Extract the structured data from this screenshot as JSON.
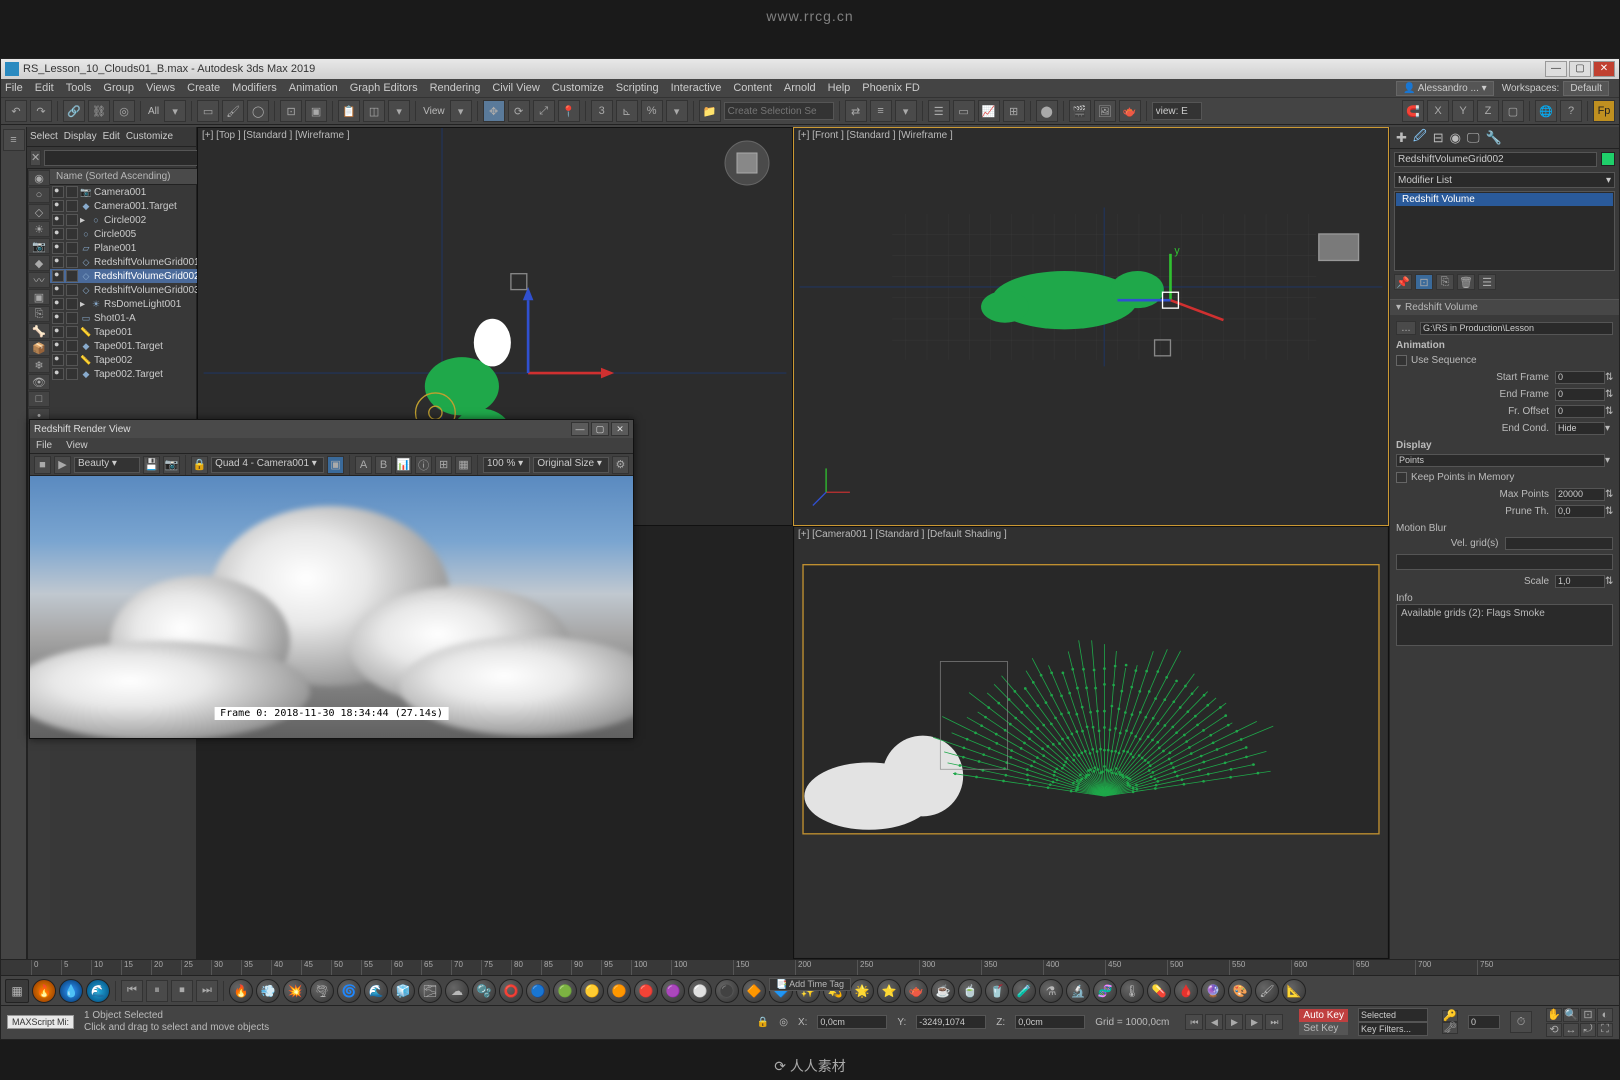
{
  "watermarks": {
    "top": "www.rrcg.cn",
    "bottom": "人人素材"
  },
  "titlebar": {
    "title": "RS_Lesson_10_Clouds01_B.max - Autodesk 3ds Max 2019"
  },
  "main_menu": [
    "File",
    "Edit",
    "Tools",
    "Group",
    "Views",
    "Create",
    "Modifiers",
    "Animation",
    "Graph Editors",
    "Rendering",
    "Civil View",
    "Customize",
    "Scripting",
    "Interactive",
    "Content",
    "Arnold",
    "Help",
    "Phoenix FD"
  ],
  "user": {
    "name": "Alessandro ...",
    "workspace_label": "Workspaces:",
    "workspace_value": "Default"
  },
  "main_toolbar": {
    "all_label": "All",
    "view_label": "View",
    "create_sel_placeholder": "Create Selection Se",
    "view_input": "view: E"
  },
  "scene_explorer": {
    "toolbar": [
      "Select",
      "Display",
      "Edit",
      "Customize"
    ],
    "header": "Name (Sorted Ascending)",
    "items": [
      {
        "name": "Camera001",
        "icon": "📷",
        "vis": true
      },
      {
        "name": "Camera001.Target",
        "icon": "◆",
        "vis": true
      },
      {
        "name": "Circle002",
        "icon": "○",
        "vis": true,
        "expand": true
      },
      {
        "name": "Circle005",
        "icon": "○",
        "vis": true
      },
      {
        "name": "Plane001",
        "icon": "▱",
        "vis": true
      },
      {
        "name": "RedshiftVolumeGrid001",
        "icon": "◇",
        "vis": true
      },
      {
        "name": "RedshiftVolumeGrid002",
        "icon": "◇",
        "vis": true,
        "selected": true
      },
      {
        "name": "RedshiftVolumeGrid003",
        "icon": "◇",
        "vis": true
      },
      {
        "name": "RsDomeLight001",
        "icon": "☀",
        "vis": true,
        "expand": true
      },
      {
        "name": "Shot01-A",
        "icon": "▭",
        "vis": true
      },
      {
        "name": "Tape001",
        "icon": "📏",
        "vis": true
      },
      {
        "name": "Tape001.Target",
        "icon": "◆",
        "vis": true
      },
      {
        "name": "Tape002",
        "icon": "📏",
        "vis": true
      },
      {
        "name": "Tape002.Target",
        "icon": "◆",
        "vis": true
      }
    ]
  },
  "viewports": {
    "top": "[+] [Top ] [Standard ] [Wireframe ]",
    "front": "[+] [Front ] [Standard ] [Wireframe ]",
    "camera": "[+] [Camera001 ] [Standard ] [Default Shading ]"
  },
  "render_view": {
    "title": "Redshift Render View",
    "menu": [
      "File",
      "View"
    ],
    "aov": "Beauty",
    "camera": "Quad 4 - Camera001",
    "zoom": "100 %",
    "size": "Original Size",
    "stamp": "Frame  0:  2018-11-30  18:34:44  (27.14s)"
  },
  "command_panel": {
    "object_name": "RedshiftVolumeGrid002",
    "modifier_list_label": "Modifier List",
    "modifier": "Redshift Volume",
    "section_title": "Redshift Volume",
    "path_btn": "...",
    "path_value": "G:\\RS in Production\\Lesson",
    "animation_label": "Animation",
    "use_sequence": "Use Sequence",
    "start_frame_label": "Start Frame",
    "start_frame": "0",
    "end_frame_label": "End Frame",
    "end_frame": "0",
    "fr_offset_label": "Fr. Offset",
    "fr_offset": "0",
    "end_cond_label": "End Cond.",
    "end_cond": "Hide",
    "display_label": "Display",
    "display_mode": "Points",
    "keep_points": "Keep Points in Memory",
    "max_points_label": "Max Points",
    "max_points": "20000",
    "prune_label": "Prune Th.",
    "prune": "0,0",
    "motion_blur": "Motion Blur",
    "vel_grid_label": "Vel. grid(s)",
    "scale_label": "Scale",
    "scale": "1,0",
    "info_label": "Info",
    "info_text": "Available grids (2):\n  Flags\n  Smoke"
  },
  "bottom": {
    "maxscript": "MAXScript Mi:",
    "selected": "1 Object Selected",
    "hint": "Click and drag to select and move objects",
    "x_label": "X:",
    "x": "0,0cm",
    "y_label": "Y:",
    "y": "-3249,1074",
    "z_label": "Z:",
    "z": "0,0cm",
    "grid": "Grid = 1000,0cm",
    "add_time_tag": "Add Time Tag",
    "auto_key": "Auto Key",
    "set_key": "Set Key",
    "selected_mode": "Selected",
    "key_filters": "Key Filters...",
    "frame": "0"
  },
  "timeline_ticks": [
    0,
    5,
    10,
    15,
    20,
    25,
    30,
    35,
    40,
    45,
    50,
    55,
    60,
    65,
    70,
    75,
    80,
    85,
    90,
    95,
    100
  ],
  "timeline_extra": [
    100,
    150,
    200,
    250,
    300,
    350,
    400,
    450,
    500,
    550,
    600,
    650,
    700,
    750
  ]
}
